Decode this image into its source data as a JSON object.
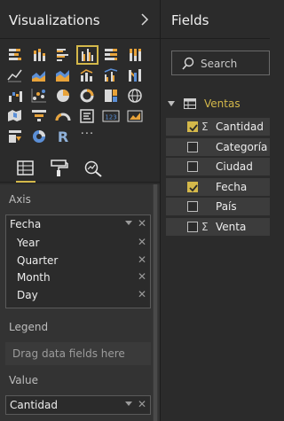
{
  "visualizations": {
    "title": "Visualizations",
    "chevron_icon": "chevron-right-icon",
    "more": "···",
    "selected_visual": "clustered-column-chart",
    "tabs": [
      "fields-tab-icon",
      "format-paint-roller-icon",
      "analytics-magnifier-icon"
    ],
    "wells": {
      "axis": {
        "label": "Axis",
        "field": "Fecha",
        "hierarchy": [
          "Year",
          "Quarter",
          "Month",
          "Day"
        ]
      },
      "legend": {
        "label": "Legend",
        "placeholder": "Drag data fields here"
      },
      "value": {
        "label": "Value",
        "field": "Cantidad"
      }
    }
  },
  "fields": {
    "title": "Fields",
    "search_placeholder": "Search",
    "table": {
      "name": "Ventas",
      "items": [
        {
          "name": "Cantidad",
          "checked": true,
          "sigma": true
        },
        {
          "name": "Categoría",
          "checked": false,
          "sigma": false
        },
        {
          "name": "Ciudad",
          "checked": false,
          "sigma": false
        },
        {
          "name": "Fecha",
          "checked": true,
          "sigma": false
        },
        {
          "name": "País",
          "checked": false,
          "sigma": false
        },
        {
          "name": "Venta",
          "checked": false,
          "sigma": true
        }
      ]
    }
  },
  "symbols": {
    "sigma": "Σ",
    "remove": "✕"
  },
  "colors": {
    "accent": "#d4b84a",
    "pane_bg": "#2b2b2b",
    "well_bg": "#333333",
    "field_row_bg": "#3c3c3c"
  }
}
